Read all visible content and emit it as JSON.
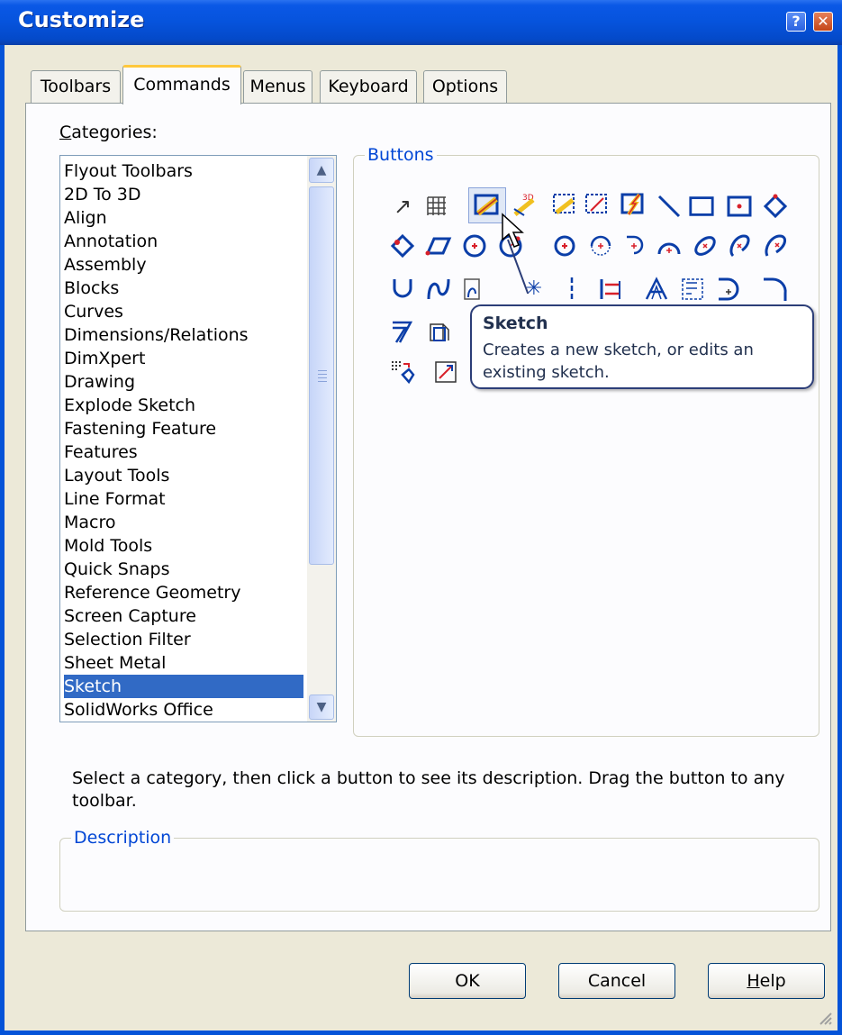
{
  "window": {
    "title": "Customize",
    "help_button": "?",
    "close_button": "✕"
  },
  "tabs": [
    {
      "label": "Toolbars",
      "active": false
    },
    {
      "label": "Commands",
      "active": true
    },
    {
      "label": "Menus",
      "active": false
    },
    {
      "label": "Keyboard",
      "active": false
    },
    {
      "label": "Options",
      "active": false
    }
  ],
  "categories": {
    "label_underlined": "C",
    "label_rest": "ategories:",
    "items": [
      "Flyout Toolbars",
      "2D To 3D",
      "Align",
      "Annotation",
      "Assembly",
      "Blocks",
      "Curves",
      "Dimensions/Relations",
      "DimXpert",
      "Drawing",
      "Explode Sketch",
      "Fastening Feature",
      "Features",
      "Layout Tools",
      "Line Format",
      "Macro",
      "Mold Tools",
      "Quick Snaps",
      "Reference Geometry",
      "Screen Capture",
      "Selection Filter",
      "Sheet Metal",
      "Sketch",
      "SolidWorks Office"
    ],
    "selected": "Sketch"
  },
  "buttons_group": {
    "legend": "Buttons",
    "icons": [
      "select-arrow-icon",
      "grid-icon",
      "sketch-icon",
      "3d-sketch-icon",
      "sketch-picture-icon",
      "convert-entities-icon",
      "smart-sketch-icon",
      "line-icon",
      "rectangle-icon",
      "center-rectangle-icon",
      "diamond-icon",
      "3-point-corner-rectangle-icon",
      "parallelogram-icon",
      "circle-icon",
      "perimeter-circle-icon",
      "centerpoint-arc-icon",
      "tangent-arc-icon",
      "3-point-arc-icon",
      "sketch-fillet-icon",
      "ellipse-icon",
      "partial-ellipse-icon",
      "parabola-icon",
      "u-shape-icon",
      "spline-icon",
      "spline-on-surface-icon",
      "point-icon",
      "centerline-icon",
      "mirror-entities-icon",
      "text-icon",
      "sketch-chamfer-icon",
      "offset-entities-icon",
      "trim-icon",
      "extend-icon",
      "polygon-icon",
      "sketch-block-icon",
      "pattern-icon",
      "move-entities-icon"
    ]
  },
  "tooltip": {
    "title": "Sketch",
    "text": "Creates a new sketch, or edits an existing sketch."
  },
  "hint": "Select a category, then click a button to see its description. Drag the button to any toolbar.",
  "description_group": {
    "legend": "Description",
    "text": ""
  },
  "footer": {
    "ok": "OK",
    "cancel": "Cancel",
    "help_underlined": "H",
    "help_rest": "elp"
  },
  "colors": {
    "titlebar": "#0653dc",
    "selection": "#316ac5",
    "group_legend": "#0046d5",
    "icon_blue": "#0b3ea8",
    "icon_red": "#d8202a",
    "icon_yellow": "#f0c020"
  }
}
